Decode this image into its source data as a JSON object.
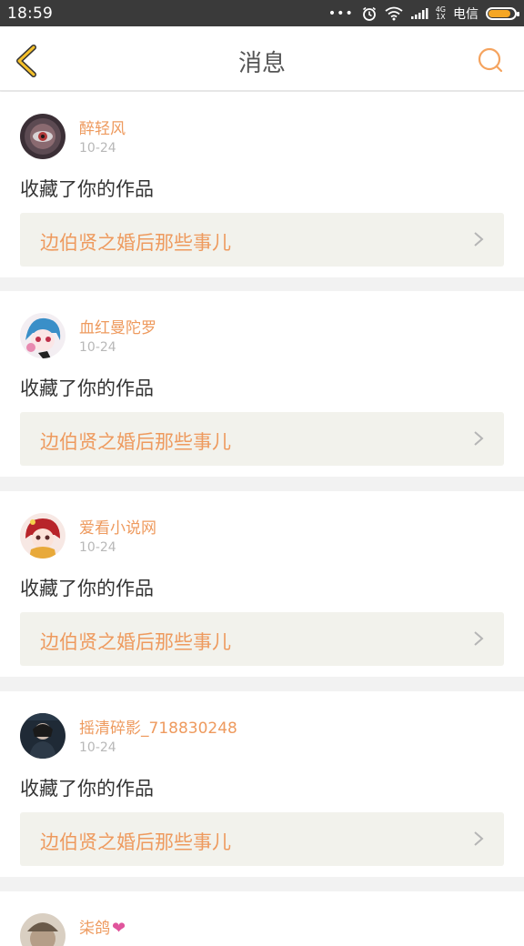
{
  "status_bar": {
    "time": "18:59",
    "dots": "•••",
    "network_top": "4G",
    "network_bottom": "1X",
    "carrier": "电信",
    "icons": [
      "alarm-icon",
      "wifi-icon",
      "signal-icon",
      "battery-icon"
    ],
    "battery_level": 0.85
  },
  "header": {
    "title": "消息",
    "back_icon": "chevron-left-icon",
    "search_icon": "search-icon",
    "accent_color": "#f5a623"
  },
  "messages": [
    {
      "username": "醉轻风",
      "date": "10-24",
      "action": "收藏了你的作品",
      "work_title": "边伯贤之婚后那些事儿"
    },
    {
      "username": "血红曼陀罗",
      "date": "10-24",
      "action": "收藏了你的作品",
      "work_title": "边伯贤之婚后那些事儿"
    },
    {
      "username": "爱看小说网",
      "date": "10-24",
      "action": "收藏了你的作品",
      "work_title": "边伯贤之婚后那些事儿"
    },
    {
      "username": "摇清碎影_718830248",
      "date": "10-24",
      "action": "收藏了你的作品",
      "work_title": "边伯贤之婚后那些事儿"
    },
    {
      "username": "柒鸽",
      "heart": "❤"
    }
  ],
  "colors": {
    "username": "#ee9a5e",
    "work_title": "#ee9a5e",
    "date": "#b8b8b8",
    "link_bg": "#f2f2ec"
  }
}
